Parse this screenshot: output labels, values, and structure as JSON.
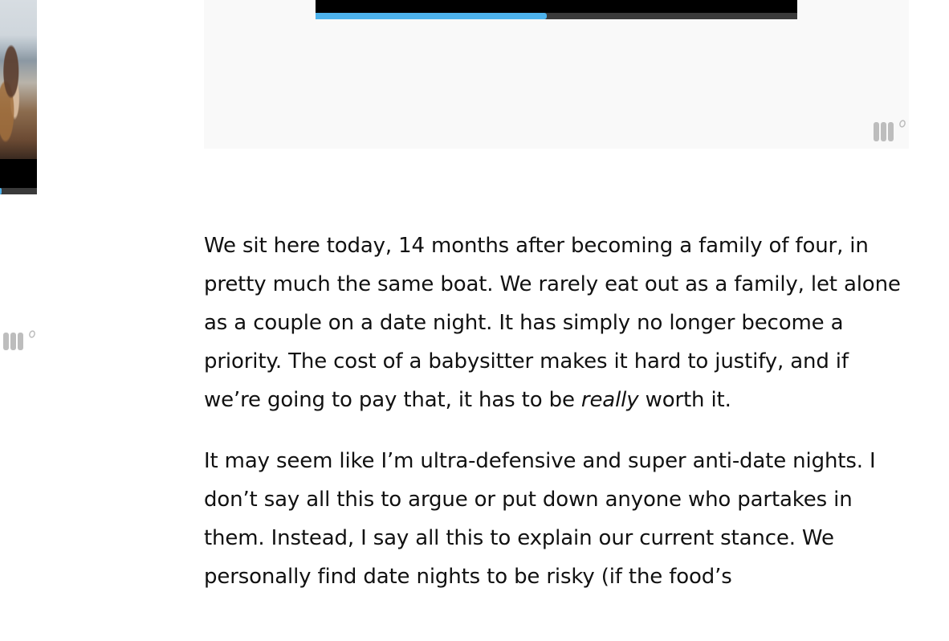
{
  "side_video": {
    "progress": 0.05,
    "logo_icon": "brand-logo-icon"
  },
  "main_player": {
    "progress": 0.48,
    "logo_icon": "brand-logo-icon"
  },
  "article": {
    "paragraph1": {
      "before": "We sit here today, 14 months after becoming a family of four, in pretty much the same boat. We rarely eat out as a family, let alone as a couple on a date night. It has simply no longer become a priority. The cost of a babysitter makes it hard to justify, and if we’re going to pay that, it has to be ",
      "emphasis": "really",
      "after": " worth it."
    },
    "paragraph2": "It may seem like I’m ultra-defensive and super anti-date nights. I don’t say all this to argue or put down anyone who partakes in them. Instead, I say all this to explain our current stance. We personally find date nights to be risky (if the food’s"
  },
  "colors": {
    "progress_fill": "#4db2ec",
    "progress_track": "#3a3a3a",
    "player_background": "#f9f9f9",
    "logo": "#bdbdbd",
    "text": "#111111"
  }
}
